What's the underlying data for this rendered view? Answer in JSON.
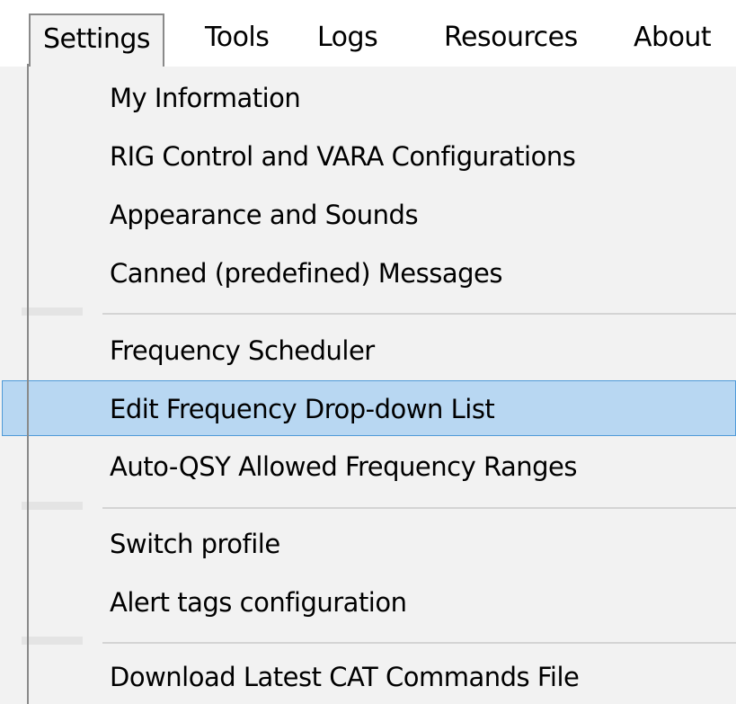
{
  "menubar": {
    "items": [
      {
        "label": "Settings"
      },
      {
        "label": "Tools"
      },
      {
        "label": "Logs"
      },
      {
        "label": "Resources"
      },
      {
        "label": "About"
      }
    ]
  },
  "settings_menu": {
    "items": [
      {
        "label": "My Information"
      },
      {
        "label": "RIG Control and VARA Configurations"
      },
      {
        "label": "Appearance and Sounds"
      },
      {
        "label": "Canned (predefined) Messages"
      },
      {
        "label": "Frequency Scheduler"
      },
      {
        "label": "Edit Frequency Drop-down List",
        "highlighted": true
      },
      {
        "label": "Auto-QSY Allowed Frequency Ranges"
      },
      {
        "label": "Switch profile"
      },
      {
        "label": "Alert tags configuration"
      },
      {
        "label": "Download Latest CAT Commands File"
      }
    ]
  },
  "colors": {
    "highlight_fill": "#b8d7f2",
    "highlight_border": "#4f9ad8",
    "menu_background": "#f2f2f2"
  }
}
